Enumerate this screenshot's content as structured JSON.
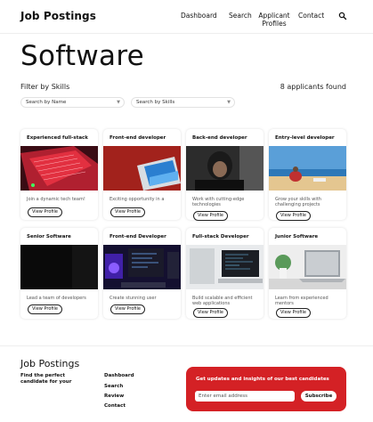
{
  "header": {
    "brand": "Job Postings",
    "nav": [
      "Dashboard",
      "Search",
      "Applicant Profiles",
      "Contact"
    ],
    "search_icon": "search-icon"
  },
  "page": {
    "title": "Software",
    "filter_label": "Filter by Skills",
    "count_text": "8 applicants found"
  },
  "filters": {
    "name_placeholder": "Search by Name",
    "skills_placeholder": "Search by Skills"
  },
  "cards": [
    {
      "title": "Experienced full-stack",
      "desc": "Join a dynamic tech team!",
      "button": "View Profile"
    },
    {
      "title": "Front-end developer",
      "desc": "Exciting opportunity in a",
      "button": "View Profile"
    },
    {
      "title": "Back-end developer",
      "desc": "Work with cutting-edge technologies",
      "button": "View Profile"
    },
    {
      "title": "Entry-level developer",
      "desc": "Grow your skills with challenging projects",
      "button": "View Profile"
    },
    {
      "title": "Senior Software",
      "desc": "Lead a team of developers",
      "button": "View Profile"
    },
    {
      "title": "Front-end Developer",
      "desc": "Create stunning user",
      "button": "View Profile"
    },
    {
      "title": "Full-stack Developer",
      "desc": "Build scalable and efficient web applications",
      "button": "View Profile"
    },
    {
      "title": "Junior Software",
      "desc": "Learn from experienced mentors",
      "button": "View Profile"
    }
  ],
  "footer": {
    "brand": "Job Postings",
    "tagline": "Find the perfect candidate for your",
    "links": [
      "Dashboard",
      "Search",
      "Review",
      "Contact"
    ],
    "newsletter_title": "Get updates and insights of our best candidates",
    "email_placeholder": "Enter email address",
    "subscribe_label": "Subscribe"
  },
  "colors": {
    "accent": "#d42125"
  }
}
